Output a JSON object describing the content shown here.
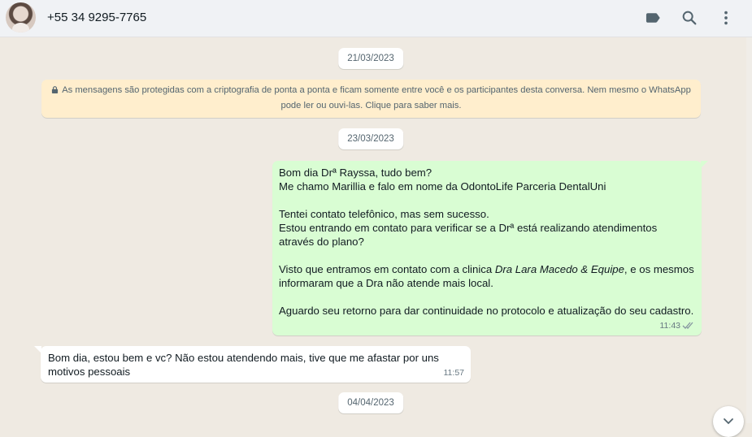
{
  "header": {
    "contact_name": "+55 34 9295-7765",
    "icons": [
      "label-icon",
      "search-icon",
      "menu-dots-icon"
    ]
  },
  "chat": {
    "date_1": "21/03/2023",
    "encryption_notice": {
      "line_1": "As mensagens são protegidas com a criptografia de ponta a ponta e ficam somente entre você e os participantes desta conversa. Nem mesmo o WhatsApp",
      "line_2": "pode ler ou ouvi-las. Clique para saber mais."
    },
    "date_2": "23/03/2023",
    "outgoing_message": {
      "line_1": "Bom dia Drª Rayssa, tudo bem?",
      "line_2": "Me chamo Marillia e falo em nome da OdontoLife Parceria DentalUni",
      "line_3": "Tentei contato telefônico, mas sem sucesso.",
      "line_4": "Estou entrando em contato para verificar se a Drª está realizando atendimentos através do plano?",
      "line_5_before": "Visto que entramos em contato com a clinica ",
      "line_5_italic": "Dra Lara Macedo & Equipe",
      "line_5_after": ", e os mesmos informaram que a Dra não atende mais local.",
      "line_6": "Aguardo seu retorno para dar continuidade no protocolo e atualização do seu cadastro.",
      "time": "11:43",
      "status": "read"
    },
    "incoming_message": {
      "text": "Bom dia, estou bem e vc? Não estou atendendo mais, tive que me afastar por uns motivos pessoais",
      "time": "11:57"
    },
    "date_3": "04/04/2023"
  },
  "colors": {
    "outgoing_bubble": "#d9fdd3",
    "incoming_bubble": "#ffffff",
    "notice_background": "#ffeecd",
    "chat_background": "#efeae2",
    "read_ticks": "#8696a0"
  }
}
